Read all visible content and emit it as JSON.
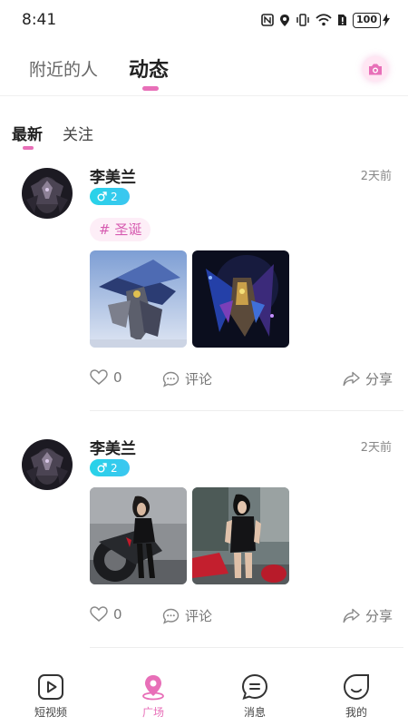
{
  "status_bar": {
    "time": "8:41",
    "battery": "100"
  },
  "header": {
    "tabs": [
      {
        "label": "附近的人"
      },
      {
        "label": "动态"
      }
    ],
    "active_color": "#e86fb8"
  },
  "subtabs": [
    {
      "label": "最新"
    },
    {
      "label": "关注"
    }
  ],
  "posts": [
    {
      "author": "李美兰",
      "time": "2天前",
      "gender_icon": "male-symbol-icon",
      "level": "2",
      "topic": "# 圣诞",
      "likes": "0",
      "comment_label": "评论",
      "share_label": "分享"
    },
    {
      "author": "李美兰",
      "time": "2天前",
      "gender_icon": "male-symbol-icon",
      "level": "2",
      "topic": "",
      "likes": "0",
      "comment_label": "评论",
      "share_label": "分享"
    }
  ],
  "bottom_nav": [
    {
      "label": "短视频",
      "icon": "play-video-icon"
    },
    {
      "label": "广场",
      "icon": "location-pin-icon"
    },
    {
      "label": "消息",
      "icon": "chat-bubble-icon"
    },
    {
      "label": "我的",
      "icon": "smile-face-icon"
    }
  ]
}
